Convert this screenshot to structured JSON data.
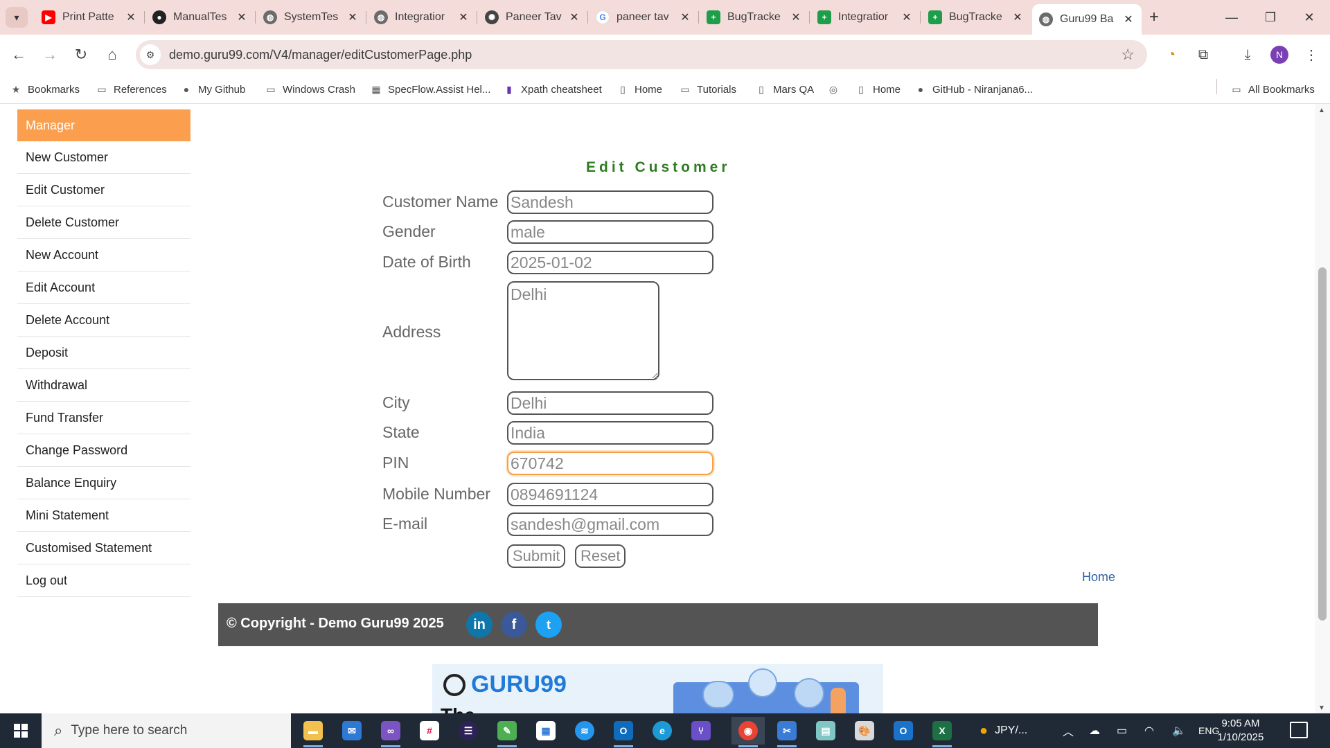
{
  "browser": {
    "tabs": [
      {
        "title": "Print Patte",
        "icon": "youtube-icon",
        "color": "#ff0000",
        "glyph": "▶"
      },
      {
        "title": "ManualTes",
        "icon": "github-icon",
        "color": "#222222",
        "glyph": "●"
      },
      {
        "title": "SystemTes",
        "icon": "globe-icon",
        "color": "#5f6368",
        "glyph": "◍"
      },
      {
        "title": "Integratior",
        "icon": "globe-icon",
        "color": "#5f6368",
        "glyph": "◍"
      },
      {
        "title": "Paneer Tav",
        "icon": "chatgpt-icon",
        "color": "#444444",
        "glyph": "✺"
      },
      {
        "title": "paneer tav",
        "icon": "google-icon",
        "color": "#4285f4",
        "glyph": "G"
      },
      {
        "title": "BugTracke",
        "icon": "sheets-icon",
        "color": "#1e9e4a",
        "glyph": "+"
      },
      {
        "title": "Integratior",
        "icon": "sheets-icon",
        "color": "#1e9e4a",
        "glyph": "+"
      },
      {
        "title": "BugTracke",
        "icon": "sheets-icon",
        "color": "#1e9e4a",
        "glyph": "+"
      },
      {
        "title": "Guru99 Ba",
        "icon": "globe-icon",
        "color": "#5f6368",
        "glyph": "◍"
      }
    ],
    "active_tab_index": 9,
    "url": "demo.guru99.com/V4/manager/editCustomerPage.php",
    "profile_initial": "N",
    "bookmarks": [
      {
        "label": "Bookmarks",
        "icon": "star-icon",
        "glyph": "★"
      },
      {
        "label": "References",
        "icon": "folder-icon",
        "glyph": "▭"
      },
      {
        "label": "My Github",
        "icon": "github-icon",
        "glyph": "●"
      },
      {
        "label": "Windows Crash",
        "icon": "folder-icon",
        "glyph": "▭"
      },
      {
        "label": "SpecFlow.Assist Hel...",
        "icon": "grid-icon",
        "glyph": "▦"
      },
      {
        "label": "Xpath cheatsheet",
        "icon": "bookmark-icon",
        "glyph": "▮"
      },
      {
        "label": "Home",
        "icon": "page-icon",
        "glyph": "▯"
      },
      {
        "label": "Tutorials",
        "icon": "folder-icon",
        "glyph": "▭"
      },
      {
        "label": "Mars QA",
        "icon": "page-icon",
        "glyph": "▯"
      },
      {
        "label": "",
        "icon": "game-icon",
        "glyph": "◎"
      },
      {
        "label": "Home",
        "icon": "page-icon",
        "glyph": "▯"
      },
      {
        "label": "GitHub - Niranjana6...",
        "icon": "github-icon",
        "glyph": "●"
      }
    ],
    "all_bookmarks": "All Bookmarks"
  },
  "sidebar": {
    "header": "Manager",
    "items": [
      "New Customer",
      "Edit Customer",
      "Delete Customer",
      "New Account",
      "Edit Account",
      "Delete Account",
      "Deposit",
      "Withdrawal",
      "Fund Transfer",
      "Change Password",
      "Balance Enquiry",
      "Mini Statement",
      "Customised Statement",
      "Log out"
    ]
  },
  "form": {
    "title": "Edit Customer",
    "labels": {
      "customer_name": "Customer Name",
      "gender": "Gender",
      "dob": "Date of Birth",
      "address": "Address",
      "city": "City",
      "state": "State",
      "pin": "PIN",
      "mobile": "Mobile Number",
      "email": "E-mail"
    },
    "values": {
      "customer_name": "Sandesh",
      "gender": "male",
      "dob": "2025-01-02",
      "address": "Delhi",
      "city": "Delhi",
      "state": "India",
      "pin": "670742",
      "mobile": "0894691124",
      "email": "sandesh@gmail.com"
    },
    "submit": "Submit",
    "reset": "Reset"
  },
  "home_link": "Home",
  "footer": {
    "copyright": "© Copyright - Demo Guru99 2025",
    "social": [
      "in",
      "f",
      "t"
    ]
  },
  "banner": {
    "logo": "GURU99",
    "text": "The"
  },
  "taskbar": {
    "search_placeholder": "Type here to search",
    "tray_text": "JPY/...",
    "language": "ENG",
    "time": "9:05 AM",
    "date": "1/10/2025"
  },
  "colors": {
    "sidebar_header": "#fb9f4f",
    "title_green": "#2e7d1f",
    "footer_bg": "#545454",
    "focus_orange": "#f7a04a",
    "browser_chrome": "#f3dcd9"
  }
}
